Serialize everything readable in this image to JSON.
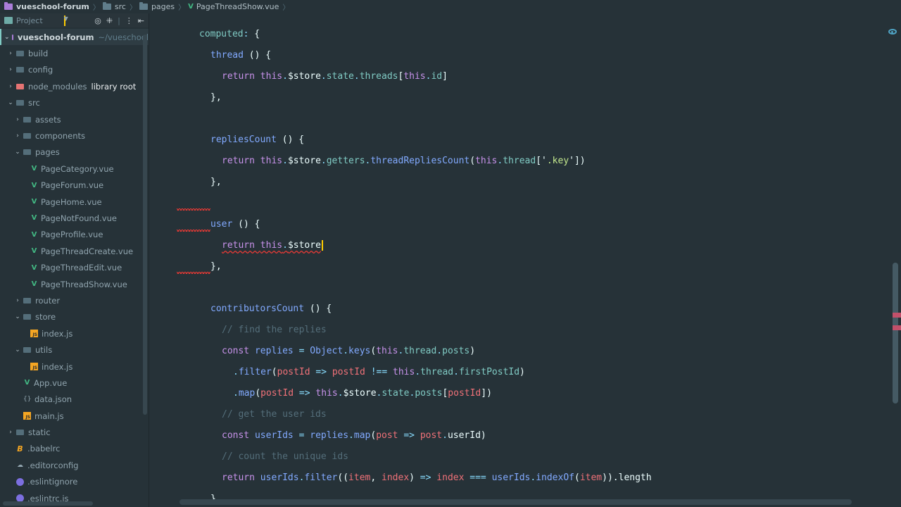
{
  "breadcrumb": [
    {
      "label": "vueschool-forum",
      "icon": "project-folder-icon",
      "root": true
    },
    {
      "label": "src",
      "icon": "folder-icon"
    },
    {
      "label": "pages",
      "icon": "folder-icon"
    },
    {
      "label": "PageThreadShow.vue",
      "icon": "vue-file-icon"
    }
  ],
  "sidebar": {
    "header_label": "Project",
    "tools": [
      "target-icon",
      "collapse-icon",
      "more-icon",
      "hide-icon"
    ],
    "tree": [
      {
        "label": "vueschool-forum",
        "sub": "~/vueschool",
        "type": "root",
        "indent": 0,
        "arrow": "down"
      },
      {
        "label": "build",
        "type": "folder",
        "indent": 1,
        "arrow": "right"
      },
      {
        "label": "config",
        "type": "folder",
        "indent": 1,
        "arrow": "right"
      },
      {
        "label": "node_modules",
        "extra": "library root",
        "type": "folder-red",
        "indent": 1,
        "arrow": "right"
      },
      {
        "label": "src",
        "type": "folder",
        "indent": 1,
        "arrow": "down"
      },
      {
        "label": "assets",
        "type": "folder",
        "indent": 2,
        "arrow": "right"
      },
      {
        "label": "components",
        "type": "folder",
        "indent": 2,
        "arrow": "right"
      },
      {
        "label": "pages",
        "type": "folder",
        "indent": 2,
        "arrow": "down"
      },
      {
        "label": "PageCategory.vue",
        "type": "vue",
        "indent": 3
      },
      {
        "label": "PageForum.vue",
        "type": "vue",
        "indent": 3
      },
      {
        "label": "PageHome.vue",
        "type": "vue",
        "indent": 3
      },
      {
        "label": "PageNotFound.vue",
        "type": "vue",
        "indent": 3
      },
      {
        "label": "PageProfile.vue",
        "type": "vue",
        "indent": 3
      },
      {
        "label": "PageThreadCreate.vue",
        "type": "vue",
        "indent": 3
      },
      {
        "label": "PageThreadEdit.vue",
        "type": "vue",
        "indent": 3
      },
      {
        "label": "PageThreadShow.vue",
        "type": "vue",
        "indent": 3
      },
      {
        "label": "router",
        "type": "folder",
        "indent": 2,
        "arrow": "right"
      },
      {
        "label": "store",
        "type": "folder",
        "indent": 2,
        "arrow": "down"
      },
      {
        "label": "index.js",
        "type": "js",
        "indent": 3
      },
      {
        "label": "utils",
        "type": "folder",
        "indent": 2,
        "arrow": "down"
      },
      {
        "label": "index.js",
        "type": "js",
        "indent": 3
      },
      {
        "label": "App.vue",
        "type": "vue",
        "indent": 2
      },
      {
        "label": "data.json",
        "type": "json",
        "indent": 2
      },
      {
        "label": "main.js",
        "type": "js",
        "indent": 2
      },
      {
        "label": "static",
        "type": "folder",
        "indent": 1,
        "arrow": "right"
      },
      {
        "label": ".babelrc",
        "type": "babel",
        "indent": 1
      },
      {
        "label": ".editorconfig",
        "type": "editorconfig",
        "indent": 1
      },
      {
        "label": ".eslintignore",
        "type": "eslint",
        "indent": 1
      },
      {
        "label": ".eslintrc.js",
        "type": "eslint",
        "indent": 1
      }
    ]
  },
  "editor": {
    "lines": [
      {
        "indent": 2,
        "tokens": [
          [
            "prop",
            "computed"
          ],
          [
            "punc",
            ": "
          ],
          [
            "brace",
            "{"
          ]
        ]
      },
      {
        "indent": 3,
        "tokens": [
          [
            "fn",
            "thread"
          ],
          [
            "plain",
            " () "
          ],
          [
            "brace",
            "{"
          ]
        ]
      },
      {
        "indent": 4,
        "tokens": [
          [
            "kw",
            "return "
          ],
          [
            "this",
            "this"
          ],
          [
            "punc",
            "."
          ],
          [
            "plain",
            "$store"
          ],
          [
            "punc",
            "."
          ],
          [
            "key",
            "state"
          ],
          [
            "punc",
            "."
          ],
          [
            "key",
            "threads"
          ],
          [
            "plain",
            "["
          ],
          [
            "this",
            "this"
          ],
          [
            "punc",
            "."
          ],
          [
            "key",
            "id"
          ],
          [
            "plain",
            "]"
          ]
        ]
      },
      {
        "indent": 3,
        "tokens": [
          [
            "brace",
            "}"
          ],
          [
            "plain",
            ","
          ]
        ]
      },
      {
        "indent": 0,
        "tokens": []
      },
      {
        "indent": 3,
        "tokens": [
          [
            "fn",
            "repliesCount"
          ],
          [
            "plain",
            " () "
          ],
          [
            "brace",
            "{"
          ]
        ]
      },
      {
        "indent": 4,
        "tokens": [
          [
            "kw",
            "return "
          ],
          [
            "this",
            "this"
          ],
          [
            "punc",
            "."
          ],
          [
            "plain",
            "$store"
          ],
          [
            "punc",
            "."
          ],
          [
            "key",
            "getters"
          ],
          [
            "punc",
            "."
          ],
          [
            "fn",
            "threadRepliesCount"
          ],
          [
            "plain",
            "("
          ],
          [
            "this",
            "this"
          ],
          [
            "punc",
            "."
          ],
          [
            "key",
            "thread"
          ],
          [
            "plain",
            "['"
          ],
          [
            "str",
            ".key"
          ],
          [
            "plain",
            "'])"
          ]
        ]
      },
      {
        "indent": 3,
        "tokens": [
          [
            "brace",
            "}"
          ],
          [
            "plain",
            ","
          ]
        ]
      },
      {
        "indent": 0,
        "tokens": [],
        "squig": true
      },
      {
        "indent": 3,
        "tokens": [
          [
            "fn",
            "user"
          ],
          [
            "plain",
            " () "
          ],
          [
            "brace",
            "{"
          ]
        ],
        "squig": true
      },
      {
        "indent": 4,
        "tokens": [
          [
            "kw",
            "return "
          ],
          [
            "this",
            "this"
          ],
          [
            "punc",
            "."
          ],
          [
            "plain",
            "$store"
          ]
        ],
        "underline": true,
        "caret": true
      },
      {
        "indent": 3,
        "tokens": [
          [
            "brace",
            "}"
          ],
          [
            "plain",
            ","
          ]
        ],
        "squig": true
      },
      {
        "indent": 0,
        "tokens": []
      },
      {
        "indent": 3,
        "tokens": [
          [
            "fn",
            "contributorsCount"
          ],
          [
            "plain",
            " () "
          ],
          [
            "brace",
            "{"
          ]
        ]
      },
      {
        "indent": 4,
        "tokens": [
          [
            "cmt",
            "// find the replies"
          ]
        ]
      },
      {
        "indent": 4,
        "tokens": [
          [
            "kw",
            "const "
          ],
          [
            "fn",
            "replies"
          ],
          [
            "punc",
            " = "
          ],
          [
            "fn",
            "Object"
          ],
          [
            "punc",
            "."
          ],
          [
            "fn",
            "keys"
          ],
          [
            "plain",
            "("
          ],
          [
            "this",
            "this"
          ],
          [
            "punc",
            "."
          ],
          [
            "key",
            "thread"
          ],
          [
            "punc",
            "."
          ],
          [
            "key",
            "posts"
          ],
          [
            "plain",
            ")"
          ]
        ]
      },
      {
        "indent": 5,
        "tokens": [
          [
            "punc",
            "."
          ],
          [
            "fn",
            "filter"
          ],
          [
            "plain",
            "("
          ],
          [
            "param",
            "postId"
          ],
          [
            "punc",
            " => "
          ],
          [
            "param",
            "postId"
          ],
          [
            "punc",
            " !== "
          ],
          [
            "this",
            "this"
          ],
          [
            "punc",
            "."
          ],
          [
            "key",
            "thread"
          ],
          [
            "punc",
            "."
          ],
          [
            "key",
            "firstPostId"
          ],
          [
            "plain",
            ")"
          ]
        ]
      },
      {
        "indent": 5,
        "tokens": [
          [
            "punc",
            "."
          ],
          [
            "fn",
            "map"
          ],
          [
            "plain",
            "("
          ],
          [
            "param",
            "postId"
          ],
          [
            "punc",
            " => "
          ],
          [
            "this",
            "this"
          ],
          [
            "punc",
            "."
          ],
          [
            "plain",
            "$store"
          ],
          [
            "punc",
            "."
          ],
          [
            "key",
            "state"
          ],
          [
            "punc",
            "."
          ],
          [
            "key",
            "posts"
          ],
          [
            "plain",
            "["
          ],
          [
            "param",
            "postId"
          ],
          [
            "plain",
            "])"
          ]
        ]
      },
      {
        "indent": 4,
        "tokens": [
          [
            "cmt",
            "// get the user ids"
          ]
        ]
      },
      {
        "indent": 4,
        "tokens": [
          [
            "kw",
            "const "
          ],
          [
            "fn",
            "userIds"
          ],
          [
            "punc",
            " = "
          ],
          [
            "fn",
            "replies"
          ],
          [
            "punc",
            "."
          ],
          [
            "fn",
            "map"
          ],
          [
            "plain",
            "("
          ],
          [
            "param",
            "post"
          ],
          [
            "punc",
            " => "
          ],
          [
            "param",
            "post"
          ],
          [
            "punc",
            "."
          ],
          [
            "plain",
            "userId)"
          ]
        ]
      },
      {
        "indent": 4,
        "tokens": [
          [
            "cmt",
            "// count the unique ids"
          ]
        ]
      },
      {
        "indent": 4,
        "tokens": [
          [
            "kw",
            "return "
          ],
          [
            "fn",
            "userIds"
          ],
          [
            "punc",
            "."
          ],
          [
            "fn",
            "filter"
          ],
          [
            "plain",
            "(("
          ],
          [
            "param",
            "item"
          ],
          [
            "plain",
            ", "
          ],
          [
            "param",
            "index"
          ],
          [
            "plain",
            ")"
          ],
          [
            "punc",
            " => "
          ],
          [
            "param",
            "index"
          ],
          [
            "punc",
            " === "
          ],
          [
            "fn",
            "userIds"
          ],
          [
            "punc",
            "."
          ],
          [
            "fn",
            "indexOf"
          ],
          [
            "plain",
            "("
          ],
          [
            "param",
            "item"
          ],
          [
            "plain",
            "))."
          ],
          [
            "plain",
            "length"
          ]
        ]
      },
      {
        "indent": 3,
        "tokens": [
          [
            "plain",
            "}"
          ]
        ]
      }
    ]
  }
}
